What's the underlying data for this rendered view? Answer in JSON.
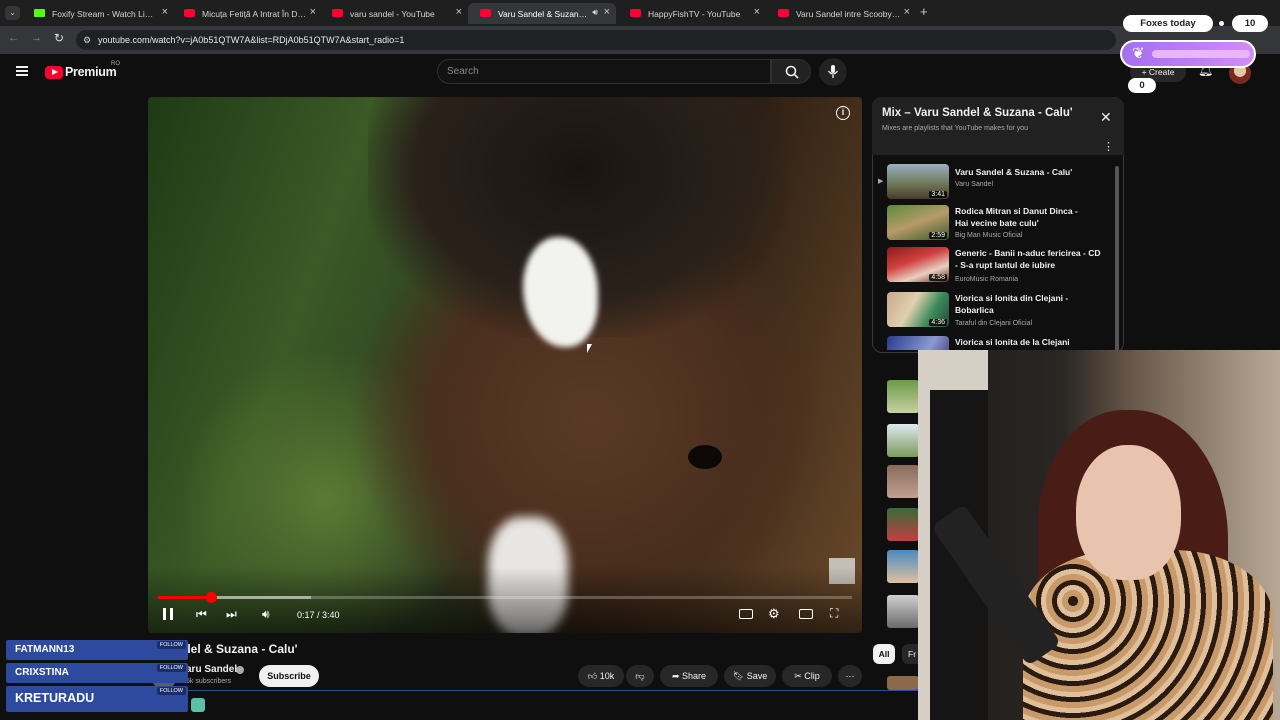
{
  "tabs": [
    {
      "title": "Foxify Stream - Watch Live on Kick",
      "favicon": "kick-icon"
    },
    {
      "title": "Micuța Fetiță A Intrat În Depresie",
      "favicon": "youtube-icon"
    },
    {
      "title": "varu sandel - YouTube",
      "favicon": "youtube-icon"
    },
    {
      "title": "Varu Sandel & Suzana - Calu'",
      "favicon": "youtube-icon",
      "active": true
    },
    {
      "title": "HappyFishTV - YouTube",
      "favicon": "youtube-icon"
    },
    {
      "title": "Varu Sandel intre Scooby Doo și",
      "favicon": "youtube-icon"
    }
  ],
  "browser": {
    "url": "youtube.com/watch?v=jA0b51QTW7A&list=RDjA0b51QTW7A&start_radio=1"
  },
  "youtube": {
    "logo_text": "Premium",
    "region": "RO",
    "search_placeholder": "Search",
    "create_label": "Create"
  },
  "player": {
    "time": "0:17 / 3:40",
    "progress_fraction": 0.077
  },
  "video": {
    "title": "ndel & Suzana - Calu'",
    "channel": "aru Sandel",
    "subscribers": "5k subscribers",
    "subscribe_label": "Subscribe",
    "likes": "10k",
    "share_label": "Share",
    "save_label": "Save",
    "clip_label": "Clip"
  },
  "playlist": {
    "title": "Mix – Varu Sandel & Suzana - Calu'",
    "subtitle": "Mixes are playlists that YouTube makes for you",
    "items": [
      {
        "title": "Varu Sandel & Suzana - Calu'",
        "channel": "Varu Sandel",
        "duration": "3:41"
      },
      {
        "title": "Rodica Mitran si Danut Dinca - Hai vecine bate culu'",
        "channel": "Big Man Music Oficial",
        "duration": "2:59"
      },
      {
        "title": "Generic - Banii n-aduc fericirea - CD - S-a rupt lantul de iubire",
        "channel": "EuroMusic Romania",
        "duration": "4:58"
      },
      {
        "title": "Viorica si Ionita din Clejani - Bobarlica",
        "channel": "Taraful din Clejani Oficial",
        "duration": "4:36"
      },
      {
        "title": "Viorica si Ionita de la Clejani",
        "channel": "",
        "duration": ""
      }
    ]
  },
  "filters": {
    "all": "All",
    "fr": "Fr"
  },
  "stream": {
    "foxes_label": "Foxes today",
    "foxes_count": "10",
    "counter": "0",
    "followers": [
      {
        "name": "FATMANN13",
        "tag": "FOLLOW"
      },
      {
        "name": "CRIXSTINA",
        "tag": "FOLLOW"
      },
      {
        "name": "KRETURADU",
        "tag": "FOLLOW"
      }
    ]
  }
}
